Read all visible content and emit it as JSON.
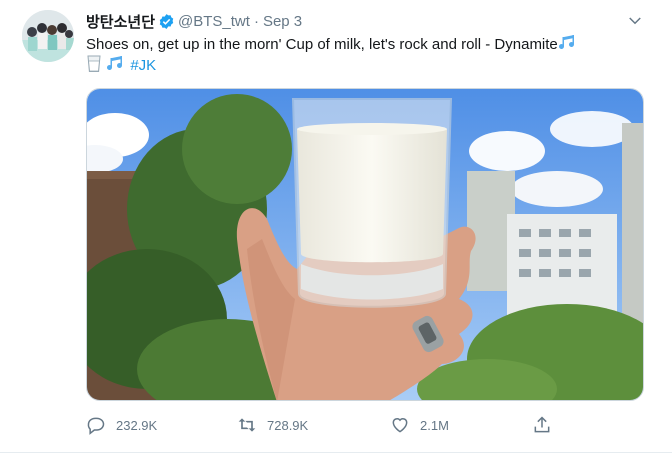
{
  "author": {
    "display_name": "방탄소년단",
    "handle": "@BTS_twt",
    "separator": "·",
    "date": "Sep 3"
  },
  "tweet": {
    "text_main": "Shoes on, get up in the morn' Cup of milk, let's rock and roll - Dynamite",
    "hashtag": "#JK"
  },
  "actions": {
    "replies": "232.9K",
    "retweets": "728.9K",
    "likes": "2.1M"
  },
  "icons": [
    "verified-badge-icon",
    "chevron-down-icon",
    "music-notes-icon",
    "milk-glass-icon",
    "reply-icon",
    "retweet-icon",
    "like-icon",
    "share-icon"
  ],
  "colors": {
    "link": "#1b95e0",
    "verified": "#1da1f2",
    "muted": "#657786"
  }
}
